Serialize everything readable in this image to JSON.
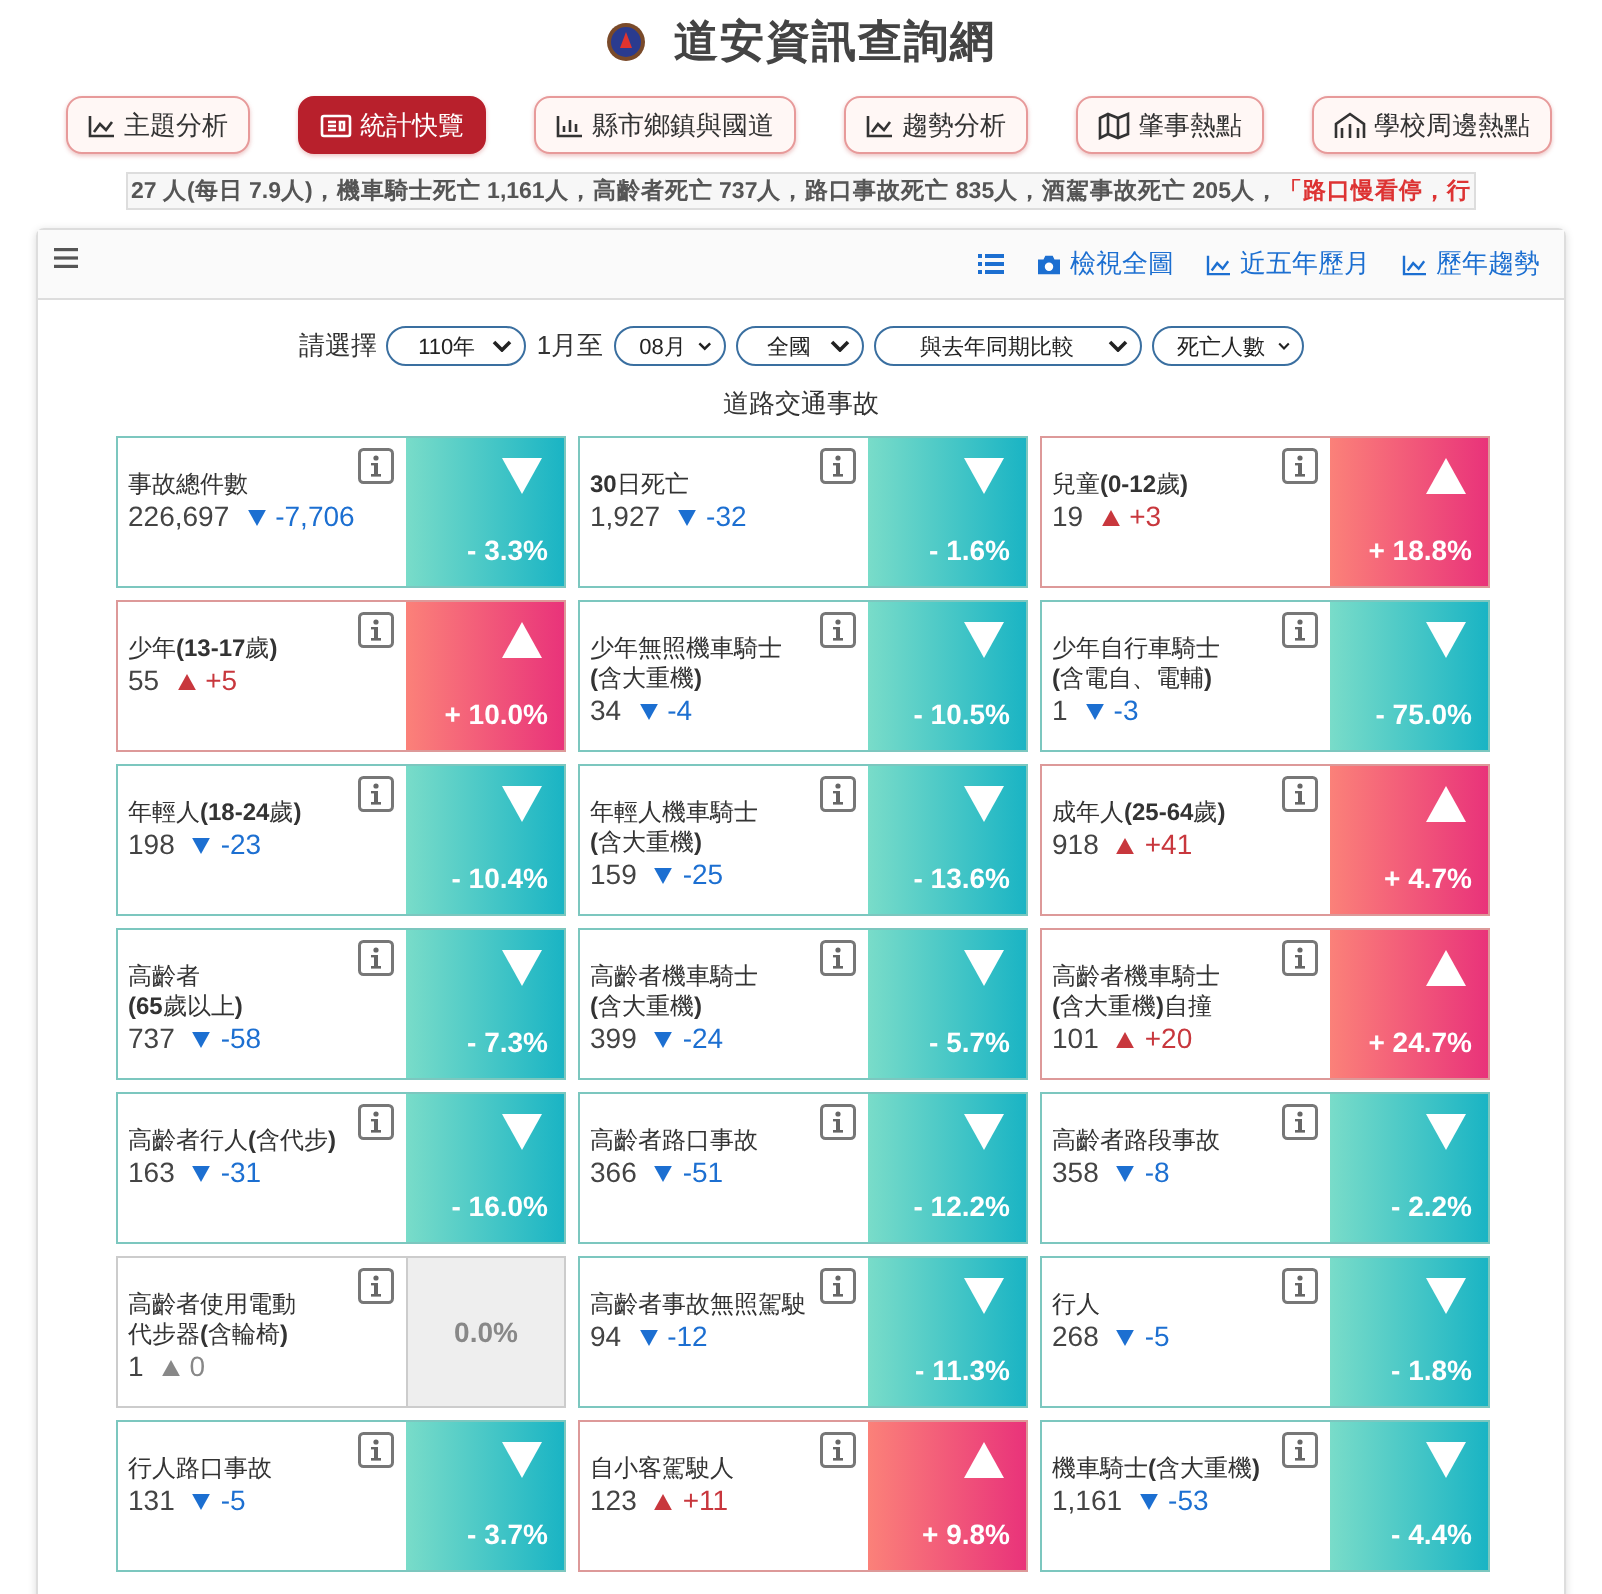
{
  "site_title": "道安資訊查詢網",
  "nav": [
    {
      "label": "主題分析",
      "selected": false
    },
    {
      "label": "統計快覽",
      "selected": true
    },
    {
      "label": "縣市鄉鎮與國道",
      "selected": false
    },
    {
      "label": "趨勢分析",
      "selected": false
    },
    {
      "label": "肇事熱點",
      "selected": false
    },
    {
      "label": "學校周邊熱點",
      "selected": false
    }
  ],
  "ticker": {
    "text": "27 人(每日 7.9人)，機車騎士死亡 **1,161**人，高齡者死亡 737人，路口事故死亡 835人，酒駕事故死亡 205人，",
    "highlight": "「路口慢看停，行"
  },
  "toolbar": [
    {
      "label": "檢視全圖"
    },
    {
      "label": "近五年歷月"
    },
    {
      "label": "歷年趨勢"
    }
  ],
  "filters": {
    "prompt": "請選擇",
    "year": "110年",
    "from": "1月至",
    "month": "08月",
    "region": "全國",
    "compare": "與去年同期比較",
    "measure": "死亡人數"
  },
  "section_title": "道路交通事故",
  "cards": [
    {
      "title": [
        "事故總件數"
      ],
      "value": "226,697",
      "delta": "-7,706",
      "percent": "- 3.3%",
      "kind": "down"
    },
    {
      "title": [
        "**30**日死亡"
      ],
      "value": "1,927",
      "delta": "-32",
      "percent": "- 1.6%",
      "kind": "down"
    },
    {
      "title": [
        "兒童**(0-12**歲**)**"
      ],
      "value": "19",
      "delta": "+3",
      "percent": "+ 18.8%",
      "kind": "up"
    },
    {
      "title": [
        "少年**(13-17**歲**)**"
      ],
      "value": "55",
      "delta": "+5",
      "percent": "+ 10.0%",
      "kind": "up"
    },
    {
      "title": [
        "少年無照機車騎士",
        "**(**含大重機**)**"
      ],
      "value": "34",
      "delta": "-4",
      "percent": "- 10.5%",
      "kind": "down"
    },
    {
      "title": [
        "少年自行車騎士",
        "**(**含電自、電輔**)**"
      ],
      "value": "1",
      "delta": "-3",
      "percent": "- 75.0%",
      "kind": "down"
    },
    {
      "title": [
        "年輕人**(18-24**歲**)**"
      ],
      "value": "198",
      "delta": "-23",
      "percent": "- 10.4%",
      "kind": "down"
    },
    {
      "title": [
        "年輕人機車騎士",
        "**(**含大重機**)**"
      ],
      "value": "159",
      "delta": "-25",
      "percent": "- 13.6%",
      "kind": "down"
    },
    {
      "title": [
        "成年人**(25-64**歲**)**"
      ],
      "value": "918",
      "delta": "+41",
      "percent": "+ 4.7%",
      "kind": "up"
    },
    {
      "title": [
        "高齡者",
        "**(65**歲以上**)**"
      ],
      "value": "737",
      "delta": "-58",
      "percent": "- 7.3%",
      "kind": "down"
    },
    {
      "title": [
        "高齡者機車騎士",
        "**(**含大重機**)**"
      ],
      "value": "399",
      "delta": "-24",
      "percent": "- 5.7%",
      "kind": "down"
    },
    {
      "title": [
        "高齡者機車騎士",
        "**(**含大重機**)**自撞"
      ],
      "value": "101",
      "delta": "+20",
      "percent": "+ 24.7%",
      "kind": "up"
    },
    {
      "title": [
        "高齡者行人**(**含代步**)**"
      ],
      "value": "163",
      "delta": "-31",
      "percent": "- 16.0%",
      "kind": "down"
    },
    {
      "title": [
        "高齡者路口事故"
      ],
      "value": "366",
      "delta": "-51",
      "percent": "- 12.2%",
      "kind": "down"
    },
    {
      "title": [
        "高齡者路段事故"
      ],
      "value": "358",
      "delta": "-8",
      "percent": "- 2.2%",
      "kind": "down"
    },
    {
      "title": [
        "高齡者使用電動",
        "代步器**(**含輪椅**)**"
      ],
      "value": "1",
      "delta": "0",
      "percent": "0.0%",
      "kind": "flat"
    },
    {
      "title": [
        "高齡者事故無照駕駛"
      ],
      "value": "94",
      "delta": "-12",
      "percent": "- 11.3%",
      "kind": "down"
    },
    {
      "title": [
        "行人"
      ],
      "value": "268",
      "delta": "-5",
      "percent": "- 1.8%",
      "kind": "down"
    },
    {
      "title": [
        "行人路口事故"
      ],
      "value": "131",
      "delta": "-5",
      "percent": "- 3.7%",
      "kind": "down"
    },
    {
      "title": [
        "自小客駕駛人"
      ],
      "value": "123",
      "delta": "+11",
      "percent": "+ 9.8%",
      "kind": "up"
    },
    {
      "title": [
        "機車騎士**(**含大重機**)**"
      ],
      "value": "1,161",
      "delta": "-53",
      "percent": "- 4.4%",
      "kind": "down"
    }
  ]
}
